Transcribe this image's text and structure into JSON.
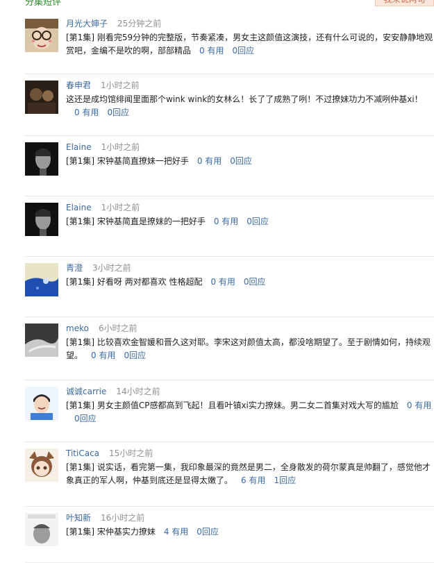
{
  "header": {
    "left_label": "分集短评",
    "right_button": "我来说两句"
  },
  "comments": [
    {
      "user": "月光大婶子",
      "time": "25分钟之前",
      "episode": "[第1集]",
      "text": "刚看完59分钟的完整版，节奏紧凑，男女主这颜值这演技，还有什么可说的，安安静静地观赏吧，金编不是吹的啊，部部精品",
      "useful": "0 有用",
      "reply": "0回应",
      "avatar": "glasses-girl"
    },
    {
      "user": "春申君",
      "time": "1小时之前",
      "episode": "",
      "text": "这还是成均馆绯闻里面那个wink wink的女林么！长了了成熟了咧！不过撩妹功力不减咧仲基xi！",
      "useful": "0 有用",
      "reply": "0回应",
      "avatar": "dark-photo"
    },
    {
      "user": "Elaine",
      "time": "1小时之前",
      "episode": "[第1集]",
      "text": "宋钟基简直撩妹一把好手",
      "useful": "0 有用",
      "reply": "0回应",
      "avatar": "bw-portrait"
    },
    {
      "user": "Elaine",
      "time": "1小时之前",
      "episode": "[第1集]",
      "text": "宋钟基简直是撩妹的一把好手",
      "useful": "0 有用",
      "reply": "0回应",
      "avatar": "bw-portrait"
    },
    {
      "user": "青澄",
      "time": "3小时之前",
      "episode": "[第1集]",
      "text": "好看呀 两对都喜欢 性格超配",
      "useful": "0 有用",
      "reply": "0回应",
      "avatar": "blue-art"
    },
    {
      "user": "meko",
      "time": "6小时之前",
      "episode": "[第1集]",
      "text": "比较喜欢金智媛和晋久这对耶。李宋这对颜值太高，都没啥期望了。至于剧情如何，持续观望。",
      "useful": "0 有用",
      "reply": "0回应",
      "avatar": "bw-hand"
    },
    {
      "user": "诚诚carrie",
      "time": "14小时之前",
      "episode": "[第1集]",
      "text": "男女主颜值CP感都高到飞起！且看叶镇xi实力撩妹。男二女二首集对戏大写的尴尬",
      "useful": "0 有用",
      "reply": "0回应",
      "avatar": "smile-boy"
    },
    {
      "user": "TitiCaca",
      "time": "15小时之前",
      "episode": "[第1集]",
      "text": "说实话，看完第一集，我印象最深的竟然是男二，全身散发的荷尔蒙真是帅翻了，感觉他才象真正的军人啊，仲基到底还是显得太嫩了。",
      "useful": "6 有用",
      "reply": "1回应",
      "avatar": "anime-girl"
    },
    {
      "user": "叶知新",
      "time": "16小时之前",
      "episode": "[第1集]",
      "text": "宋仲基实力撩妹",
      "useful": "4 有用",
      "reply": "0回应",
      "avatar": "poster"
    }
  ]
}
